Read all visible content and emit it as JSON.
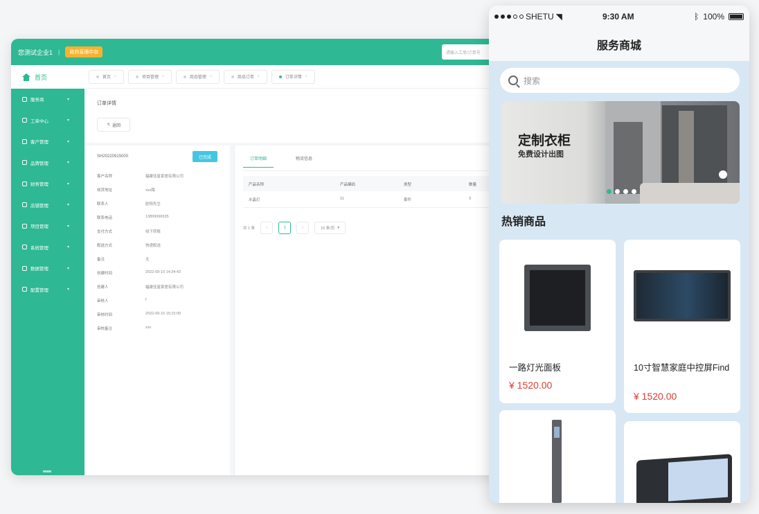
{
  "admin": {
    "brand": "您测试企业1",
    "separator": "|",
    "tag": "政府直播中台",
    "search_placeholder": "请输入工单/订单号",
    "home_label": "首页",
    "sidebar_items": [
      "服务商",
      "工单中心",
      "客户管理",
      "品牌管理",
      "财务管理",
      "店铺管理",
      "项目管理",
      "系统管理",
      "数据管理",
      "配置管理"
    ],
    "tabs": [
      "首页",
      "项目管理",
      "商品管理",
      "商品订单",
      "订单详情"
    ],
    "detail_title": "订单详情",
    "back_label": "返回",
    "order_no": "SH20220915000",
    "status_badge": "已完成",
    "info": [
      {
        "k": "客户名称",
        "v": "福建佳星家居有限公司"
      },
      {
        "k": "收货地址",
        "v": "xxx路"
      },
      {
        "k": "联系人",
        "v": "欧阳先生"
      },
      {
        "k": "联系电话",
        "v": "13899996535"
      },
      {
        "k": "支付方式",
        "v": "线下转账"
      },
      {
        "k": "配送方式",
        "v": "快递配送"
      },
      {
        "k": "备注",
        "v": "无"
      },
      {
        "k": "创建时间",
        "v": "2022-09-15 14:34:43"
      },
      {
        "k": "创建人",
        "v": "福建佳星家居有限公司"
      },
      {
        "k": "审核人",
        "v": "f"
      },
      {
        "k": "审核时间",
        "v": "2022-09-15 15:15:09"
      },
      {
        "k": "审核备注",
        "v": "xxx"
      }
    ],
    "product_tabs": [
      "订单明细",
      "物流信息"
    ],
    "table_headers": [
      "产品名称",
      "产品编码",
      "类型",
      "数量"
    ],
    "table_row": [
      "水晶灯",
      "11",
      "套件",
      "3"
    ],
    "pager": {
      "total": "共 1 条",
      "prev": "‹",
      "page": "1",
      "next": "›",
      "size": "10 条/页"
    }
  },
  "phone": {
    "carrier": "SHETU",
    "time": "9:30 AM",
    "battery": "100%",
    "title": "服务商城",
    "search_placeholder": "搜索",
    "banner_title": "定制衣柜",
    "banner_subtitle": "免费设计出图",
    "section_title": "热销商品",
    "products": [
      {
        "name": "一路灯光面板",
        "price": "¥ 1520.00"
      },
      {
        "name": "10寸智慧家庭中控屏Find",
        "price": "¥ 1520.00"
      }
    ]
  },
  "colors": {
    "accent": "#2eb893",
    "price": "#e03b2e",
    "badge": "#45c6e0",
    "tag": "#f8b22d"
  }
}
